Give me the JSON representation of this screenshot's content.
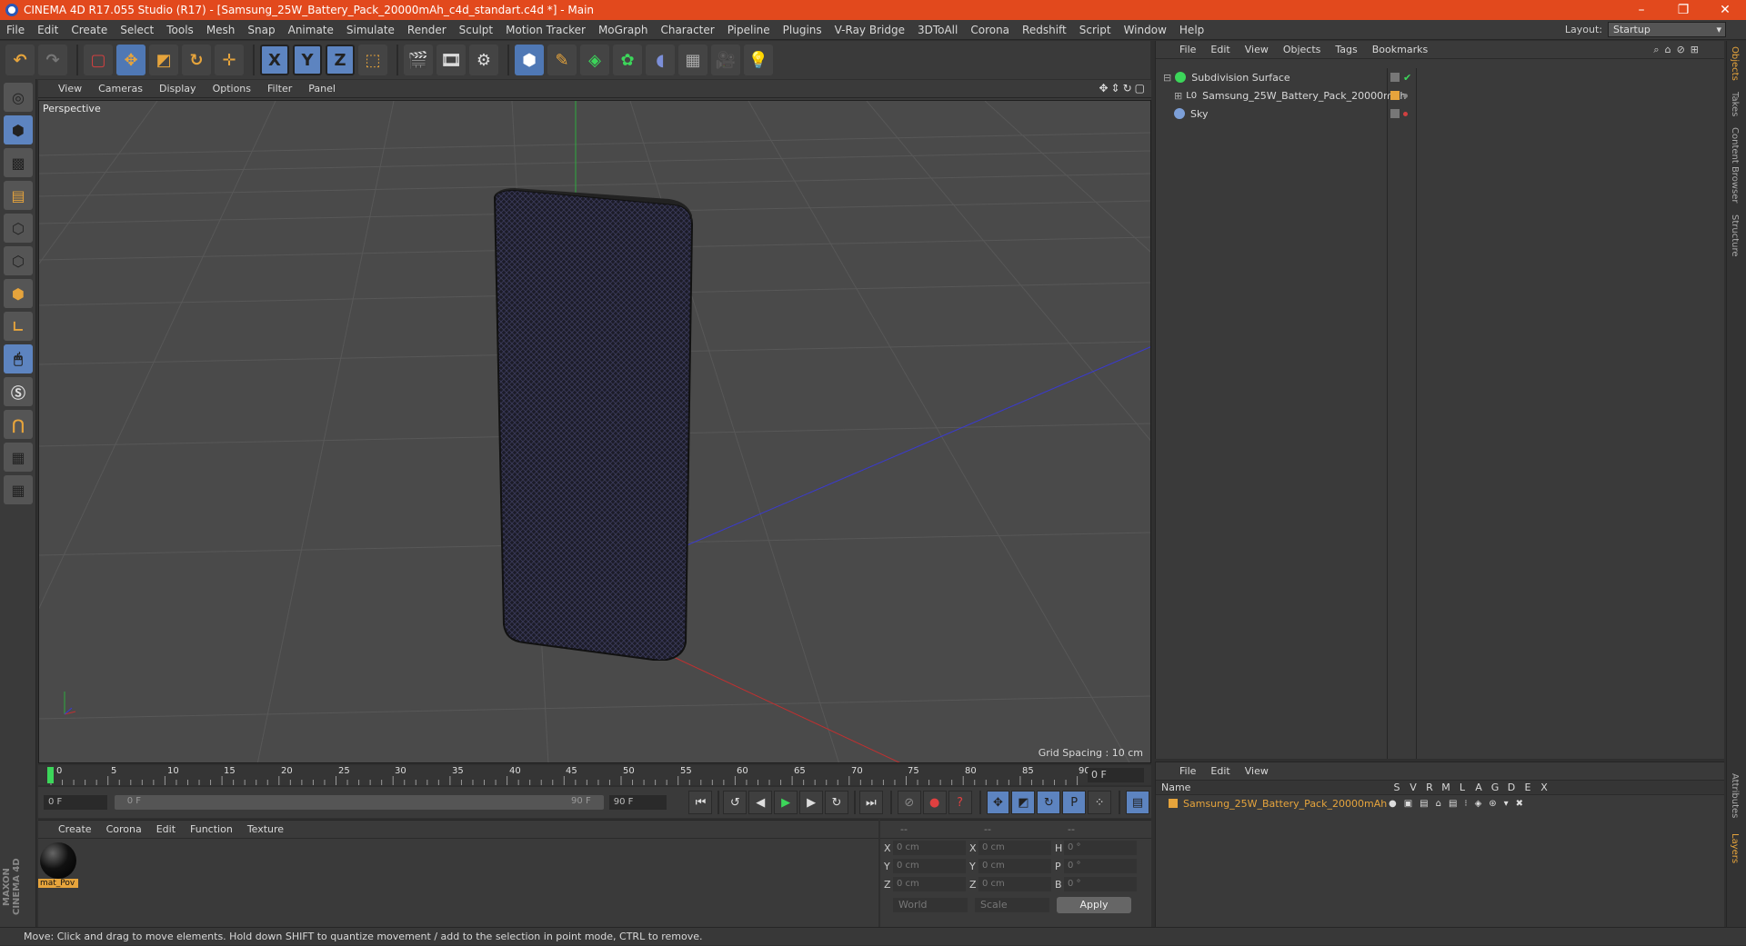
{
  "title": "CINEMA 4D R17.055 Studio (R17) - [Samsung_25W_Battery_Pack_20000mAh_c4d_standart.c4d *] - Main",
  "menu": [
    "File",
    "Edit",
    "Create",
    "Select",
    "Tools",
    "Mesh",
    "Snap",
    "Animate",
    "Simulate",
    "Render",
    "Sculpt",
    "Motion Tracker",
    "MoGraph",
    "Character",
    "Pipeline",
    "Plugins",
    "V-Ray Bridge",
    "3DToAll",
    "Corona",
    "Redshift",
    "Script",
    "Window",
    "Help"
  ],
  "layout": {
    "label": "Layout:",
    "value": "Startup"
  },
  "viewport": {
    "menu": [
      "View",
      "Cameras",
      "Display",
      "Options",
      "Filter",
      "Panel"
    ],
    "label": "Perspective",
    "grid_spacing": "Grid Spacing : 10 cm"
  },
  "timeline": {
    "ticks": [
      "0",
      "5",
      "10",
      "15",
      "20",
      "25",
      "30",
      "35",
      "40",
      "45",
      "50",
      "55",
      "60",
      "65",
      "70",
      "75",
      "80",
      "85",
      "90"
    ],
    "frame_display": "0 F",
    "start": "0 F",
    "range_start": "0 F",
    "range_end": "90 F",
    "end": "90 F"
  },
  "material_panel": {
    "menu": [
      "Create",
      "Corona",
      "Edit",
      "Function",
      "Texture"
    ],
    "material_name": "mat_Pov"
  },
  "coord_panel": {
    "headers": [
      "--",
      "--",
      "--"
    ],
    "rows": [
      {
        "a1": "X",
        "v1": "0 cm",
        "a2": "X",
        "v2": "0 cm",
        "a3": "H",
        "v3": "0 °"
      },
      {
        "a1": "Y",
        "v1": "0 cm",
        "a2": "Y",
        "v2": "0 cm",
        "a3": "P",
        "v3": "0 °"
      },
      {
        "a1": "Z",
        "v1": "0 cm",
        "a2": "Z",
        "v2": "0 cm",
        "a3": "B",
        "v3": "0 °"
      }
    ],
    "mode": "World",
    "transform": "Scale",
    "apply": "Apply"
  },
  "object_manager": {
    "menu": [
      "File",
      "Edit",
      "View",
      "Objects",
      "Tags",
      "Bookmarks"
    ],
    "objects": [
      {
        "name": "Subdivision Surface",
        "indent": 0
      },
      {
        "name": "Samsung_25W_Battery_Pack_20000mAh",
        "indent": 1
      },
      {
        "name": "Sky",
        "indent": 0
      }
    ]
  },
  "layer_manager": {
    "menu": [
      "File",
      "Edit",
      "View"
    ],
    "name_header": "Name",
    "columns": [
      "S",
      "V",
      "R",
      "M",
      "L",
      "A",
      "G",
      "D",
      "E",
      "X"
    ],
    "layers": [
      "Samsung_25W_Battery_Pack_20000mAh"
    ]
  },
  "side_tabs": [
    "Objects",
    "Takes",
    "Content Browser",
    "Structure"
  ],
  "side_tabs_lower": [
    "Attributes",
    "Layers"
  ],
  "status": "Move: Click and drag to move elements. Hold down SHIFT to quantize movement / add to the selection in point mode, CTRL to remove.",
  "colors": {
    "title_bar": "#e2491d",
    "accent": "#e6a43c",
    "tool_blue": "#5d84c0"
  }
}
